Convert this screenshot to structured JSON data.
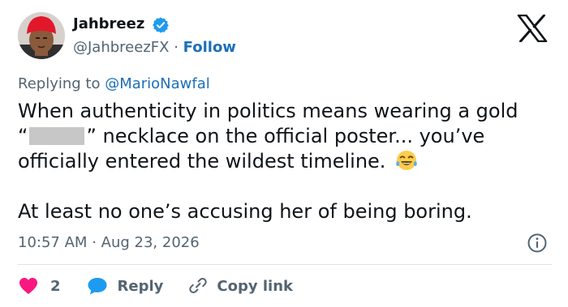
{
  "author": {
    "name": "Jahbreez",
    "handle": "@JahbreezFX",
    "separator": "·",
    "follow_label": "Follow"
  },
  "reply_context": {
    "prefix": "Replying to ",
    "mention": "@MarioNawfal"
  },
  "body": {
    "line1": "When authenticity in politics means wearing a gold",
    "line2_open_quote": "“",
    "line2_rest": "” necklace on the official poster... you’ve",
    "line3": "officially entered the wildest timeline.",
    "line3_emoji": "face-with-tears-of-joy-emoji",
    "line4": "At least no one’s accusing her of being boring."
  },
  "meta": {
    "time": "10:57 AM",
    "separator": "·",
    "date": "Aug 23, 2026"
  },
  "actions": {
    "like_count": "2",
    "reply_label": "Reply",
    "copy_link_label": "Copy link"
  },
  "icons": {
    "verified": "verified-badge-icon",
    "brand": "x-logo-icon",
    "info": "info-icon",
    "like": "heart-icon",
    "reply": "reply-bubble-icon",
    "copy": "link-icon"
  },
  "colors": {
    "text": "#0f1419",
    "secondary": "#536471",
    "link": "#1d6fb8",
    "verified": "#1d9bf0",
    "like": "#f91880",
    "divider": "#dde3e8"
  }
}
